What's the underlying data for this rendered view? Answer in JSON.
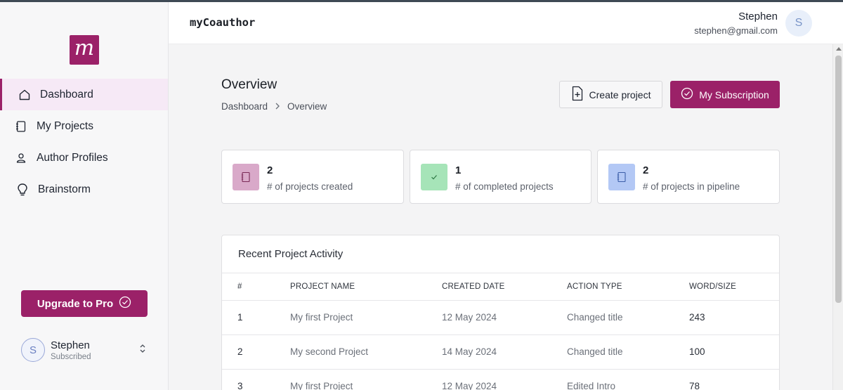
{
  "app": {
    "title": "myCoauthor",
    "logo_letter": "m",
    "brand_color": "#9b2168"
  },
  "sidebar": {
    "items": [
      {
        "label": "Dashboard",
        "icon": "home-icon",
        "active": true
      },
      {
        "label": "My Projects",
        "icon": "notebook-icon",
        "active": false
      },
      {
        "label": "Author Profiles",
        "icon": "user-icon",
        "active": false
      },
      {
        "label": "Brainstorm",
        "icon": "lightbulb-icon",
        "active": false
      }
    ],
    "upgrade_label": "Upgrade to Pro",
    "user": {
      "initial": "S",
      "name": "Stephen",
      "status": "Subscribed"
    }
  },
  "header": {
    "user_name": "Stephen",
    "user_email": "stephen@gmail.com",
    "avatar_initial": "S"
  },
  "page": {
    "title": "Overview",
    "breadcrumb": [
      "Dashboard",
      "Overview"
    ],
    "create_label": "Create project",
    "subscription_label": "My Subscription"
  },
  "stats": [
    {
      "value": "2",
      "label": "# of projects created",
      "icon": "notebook-icon",
      "color": "#d9a9c9"
    },
    {
      "value": "1",
      "label": "# of completed projects",
      "icon": "check-icon",
      "color": "#a6e4b8"
    },
    {
      "value": "2",
      "label": "# of projects in pipeline",
      "icon": "notebook-icon",
      "color": "#b3c8f5"
    }
  ],
  "activity": {
    "title": "Recent Project Activity",
    "columns": [
      "#",
      "PROJECT NAME",
      "CREATED DATE",
      "ACTION TYPE",
      "WORD/SIZE"
    ],
    "rows": [
      {
        "n": "1",
        "name": "My first Project",
        "date": "12 May 2024",
        "action": "Changed title",
        "size": "243"
      },
      {
        "n": "2",
        "name": "My second Project",
        "date": "14 May 2024",
        "action": "Changed title",
        "size": "100"
      },
      {
        "n": "3",
        "name": "My first Project",
        "date": "12 May 2024",
        "action": "Edited Intro",
        "size": "78"
      }
    ]
  }
}
